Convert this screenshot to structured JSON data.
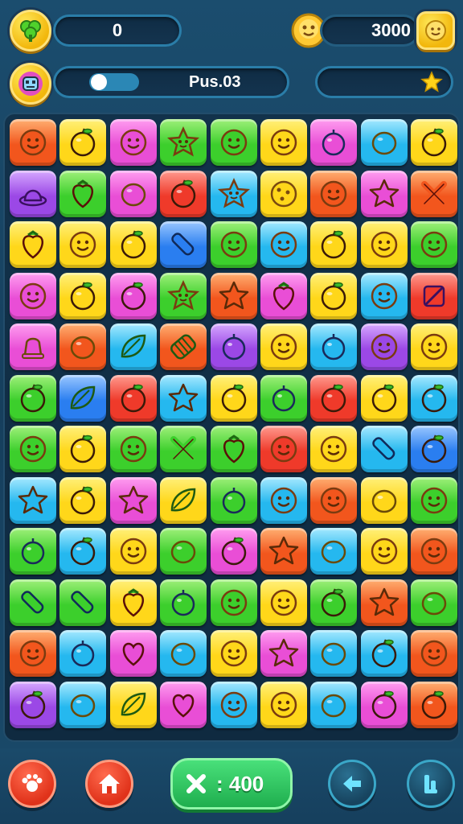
{
  "hud": {
    "score_value": "0",
    "coins_value": "3000",
    "level_label": "Pus.03"
  },
  "bottom_bar": {
    "moves_value": ": 400"
  },
  "colors": {
    "orange": "#f2561d",
    "yellow": "#ffd71a",
    "pink": "#e94ed6",
    "green": "#3ccf2c",
    "cyan": "#25b8ef",
    "purple": "#9b48e6",
    "red": "#ef3a2a",
    "blue": "#2a7ef0"
  },
  "board": {
    "rows": [
      [
        [
          "orange",
          "face-icon"
        ],
        [
          "yellow",
          "apple-icon"
        ],
        [
          "pink",
          "face-icon"
        ],
        [
          "green",
          "star-face-icon"
        ],
        [
          "green",
          "face-icon"
        ],
        [
          "yellow",
          "face-icon"
        ],
        [
          "pink",
          "berry-icon"
        ],
        [
          "cyan",
          "lemon-icon"
        ],
        [
          "yellow",
          "apple-icon"
        ]
      ],
      [
        [
          "purple",
          "hat-icon"
        ],
        [
          "green",
          "strawberry-icon"
        ],
        [
          "pink",
          "lemon-icon"
        ],
        [
          "red",
          "apple-icon"
        ],
        [
          "cyan",
          "star-face-icon"
        ],
        [
          "yellow",
          "cookie-icon"
        ],
        [
          "orange",
          "face-icon"
        ],
        [
          "pink",
          "star-icon"
        ],
        [
          "orange",
          "cross-icon"
        ]
      ],
      [
        [
          "yellow",
          "strawberry-icon"
        ],
        [
          "yellow",
          "face-icon"
        ],
        [
          "yellow",
          "apple-icon"
        ],
        [
          "blue",
          "pencil-icon"
        ],
        [
          "green",
          "face-icon"
        ],
        [
          "cyan",
          "face-icon"
        ],
        [
          "yellow",
          "apple-icon"
        ],
        [
          "yellow",
          "face-icon"
        ],
        [
          "green",
          "face-icon"
        ]
      ],
      [
        [
          "pink",
          "face-icon"
        ],
        [
          "yellow",
          "apple-icon"
        ],
        [
          "pink",
          "apple-icon"
        ],
        [
          "green",
          "star-face-icon"
        ],
        [
          "orange",
          "star-icon"
        ],
        [
          "pink",
          "strawberry-icon"
        ],
        [
          "yellow",
          "apple-icon"
        ],
        [
          "cyan",
          "face-icon"
        ],
        [
          "red",
          "bar-icon"
        ]
      ],
      [
        [
          "pink",
          "bell-icon"
        ],
        [
          "orange",
          "lemon-icon"
        ],
        [
          "cyan",
          "leaf-icon"
        ],
        [
          "orange",
          "stripes-icon"
        ],
        [
          "purple",
          "berry-icon"
        ],
        [
          "yellow",
          "face-icon"
        ],
        [
          "cyan",
          "berry-icon"
        ],
        [
          "purple",
          "face-icon"
        ],
        [
          "yellow",
          "face-icon"
        ]
      ],
      [
        [
          "green",
          "apple-icon"
        ],
        [
          "blue",
          "leaf-icon"
        ],
        [
          "red",
          "apple-icon"
        ],
        [
          "cyan",
          "star-icon"
        ],
        [
          "yellow",
          "apple-icon"
        ],
        [
          "green",
          "berry-icon"
        ],
        [
          "red",
          "apple-icon"
        ],
        [
          "yellow",
          "apple-icon"
        ],
        [
          "cyan",
          "apple-icon"
        ]
      ],
      [
        [
          "green",
          "face-icon"
        ],
        [
          "yellow",
          "apple-icon"
        ],
        [
          "green",
          "face-icon"
        ],
        [
          "green",
          "cross-icon"
        ],
        [
          "green",
          "strawberry-icon"
        ],
        [
          "red",
          "face-icon"
        ],
        [
          "yellow",
          "face-icon"
        ],
        [
          "cyan",
          "pencil-icon"
        ],
        [
          "blue",
          "apple-icon"
        ]
      ],
      [
        [
          "cyan",
          "star-icon"
        ],
        [
          "yellow",
          "apple-icon"
        ],
        [
          "pink",
          "star-icon"
        ],
        [
          "yellow",
          "leaf-icon"
        ],
        [
          "green",
          "berry-icon"
        ],
        [
          "cyan",
          "face-icon"
        ],
        [
          "orange",
          "face-icon"
        ],
        [
          "yellow",
          "lemon-icon"
        ],
        [
          "green",
          "face-icon"
        ]
      ],
      [
        [
          "green",
          "berry-icon"
        ],
        [
          "cyan",
          "apple-icon"
        ],
        [
          "yellow",
          "face-icon"
        ],
        [
          "green",
          "lemon-icon"
        ],
        [
          "pink",
          "apple-icon"
        ],
        [
          "orange",
          "star-icon"
        ],
        [
          "cyan",
          "lemon-icon"
        ],
        [
          "yellow",
          "face-icon"
        ],
        [
          "orange",
          "face-icon"
        ]
      ],
      [
        [
          "green",
          "pencil-icon"
        ],
        [
          "green",
          "pencil-icon"
        ],
        [
          "yellow",
          "strawberry-icon"
        ],
        [
          "green",
          "berry-icon"
        ],
        [
          "green",
          "face-icon"
        ],
        [
          "yellow",
          "face-icon"
        ],
        [
          "green",
          "apple-icon"
        ],
        [
          "orange",
          "star-icon"
        ],
        [
          "green",
          "lemon-icon"
        ]
      ],
      [
        [
          "orange",
          "face-icon"
        ],
        [
          "cyan",
          "berry-icon"
        ],
        [
          "pink",
          "heart-icon"
        ],
        [
          "cyan",
          "lemon-icon"
        ],
        [
          "yellow",
          "face-icon"
        ],
        [
          "pink",
          "star-icon"
        ],
        [
          "cyan",
          "lemon-icon"
        ],
        [
          "cyan",
          "apple-icon"
        ],
        [
          "orange",
          "face-icon"
        ]
      ],
      [
        [
          "purple",
          "apple-icon"
        ],
        [
          "cyan",
          "lemon-icon"
        ],
        [
          "yellow",
          "leaf-icon"
        ],
        [
          "pink",
          "heart-icon"
        ],
        [
          "cyan",
          "face-icon"
        ],
        [
          "yellow",
          "face-icon"
        ],
        [
          "cyan",
          "lemon-icon"
        ],
        [
          "pink",
          "apple-icon"
        ],
        [
          "orange",
          "apple-icon"
        ]
      ]
    ]
  }
}
